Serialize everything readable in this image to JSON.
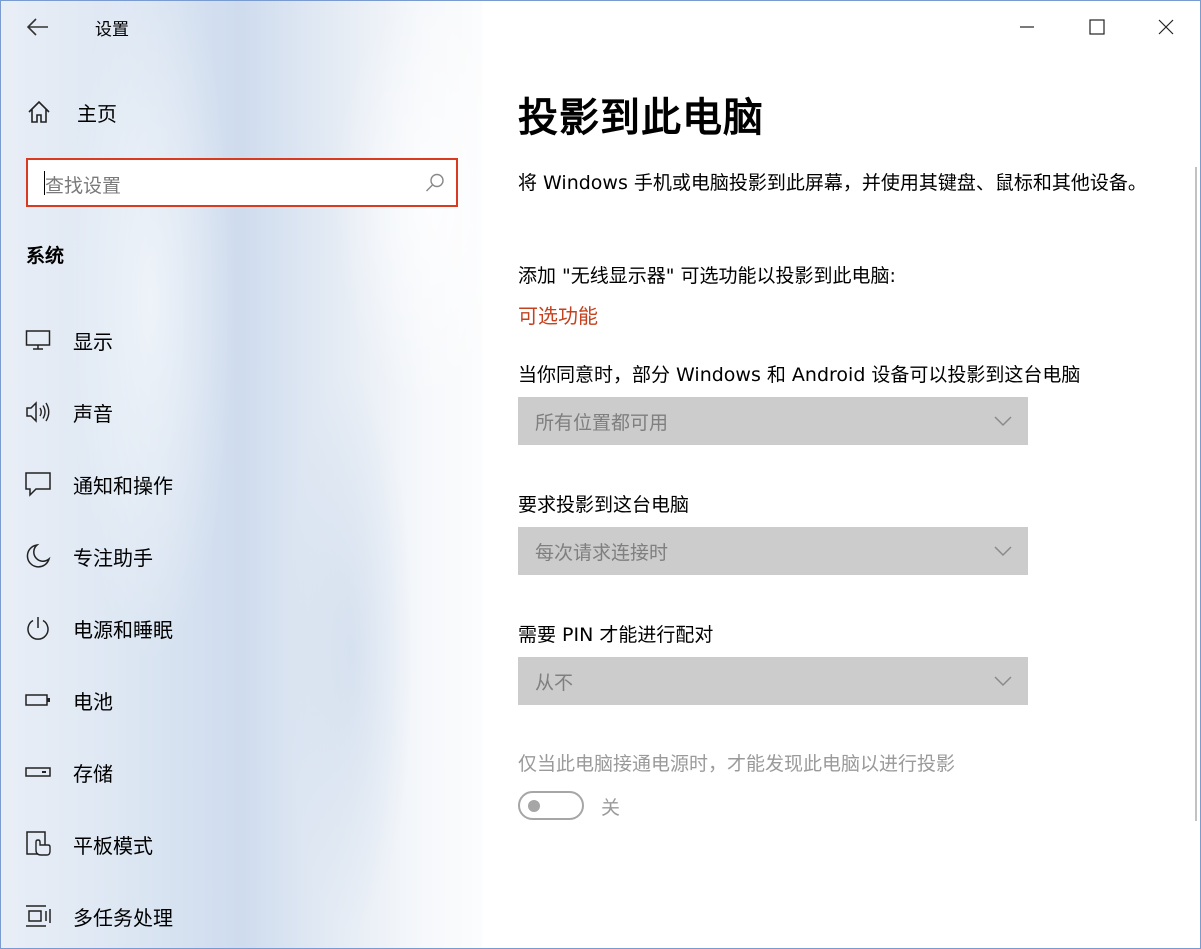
{
  "window": {
    "title": "设置"
  },
  "sidebar": {
    "home_label": "主页",
    "search_placeholder": "查找设置",
    "section_title": "系统",
    "items": [
      {
        "label": "显示",
        "icon": "monitor-icon"
      },
      {
        "label": "声音",
        "icon": "speaker-icon"
      },
      {
        "label": "通知和操作",
        "icon": "notification-icon"
      },
      {
        "label": "专注助手",
        "icon": "moon-icon"
      },
      {
        "label": "电源和睡眠",
        "icon": "power-icon"
      },
      {
        "label": "电池",
        "icon": "battery-icon"
      },
      {
        "label": "存储",
        "icon": "storage-icon"
      },
      {
        "label": "平板模式",
        "icon": "tablet-icon"
      },
      {
        "label": "多任务处理",
        "icon": "multitask-icon"
      }
    ]
  },
  "main": {
    "title": "投影到此电脑",
    "description": "将 Windows 手机或电脑投影到此屏幕，并使用其键盘、鼠标和其他设备。",
    "add_feature_text": "添加 \"无线显示器\" 可选功能以投影到此电脑:",
    "optional_features_link": "可选功能",
    "fields": [
      {
        "label": "当你同意时，部分 Windows 和 Android 设备可以投影到这台电脑",
        "value": "所有位置都可用"
      },
      {
        "label": "要求投影到这台电脑",
        "value": "每次请求连接时"
      },
      {
        "label": "需要 PIN 才能进行配对",
        "value": "从不"
      }
    ],
    "power_text": "仅当此电脑接通电源时，才能发现此电脑以进行投影",
    "toggle_state": "关"
  },
  "colors": {
    "accent": "#d83b1f",
    "link": "#c4421f",
    "disabled_dropdown": "#cccccc"
  }
}
